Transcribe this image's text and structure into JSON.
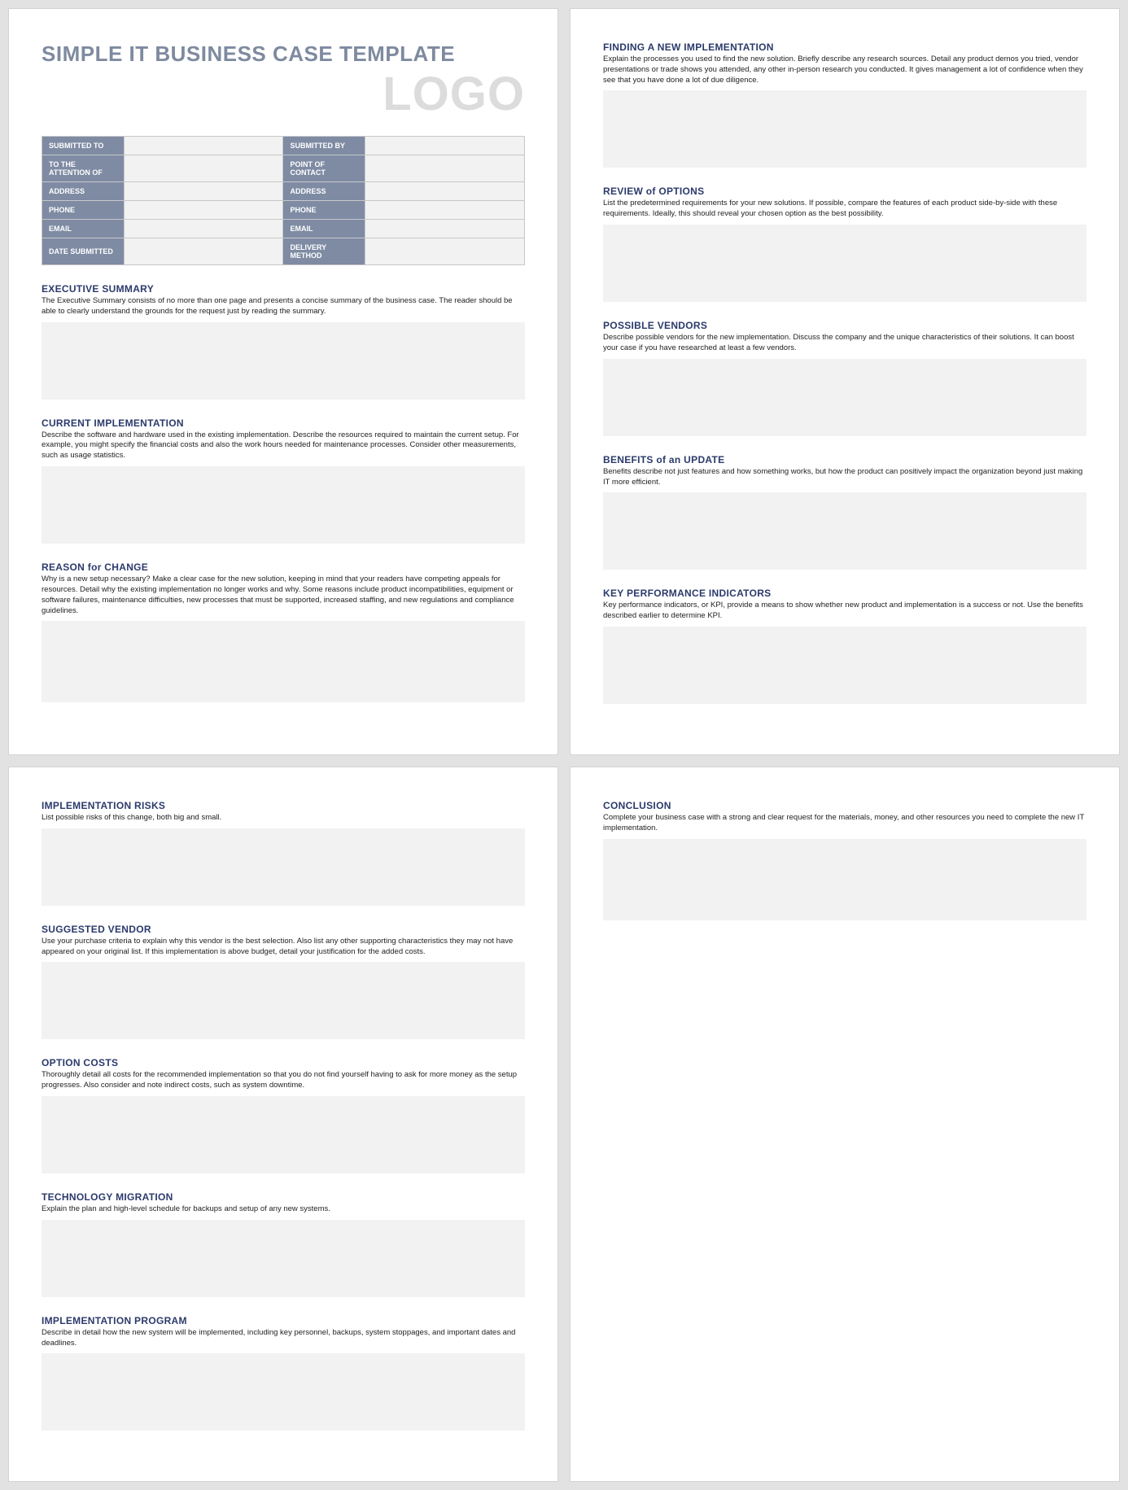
{
  "doc_title": "SIMPLE IT BUSINESS CASE TEMPLATE",
  "logo_text": "LOGO",
  "header_table": {
    "rows": [
      {
        "l1": "SUBMITTED TO",
        "l2": "SUBMITTED BY"
      },
      {
        "l1": "TO THE ATTENTION OF",
        "l2": "POINT OF CONTACT"
      },
      {
        "l1": "ADDRESS",
        "l2": "ADDRESS"
      },
      {
        "l1": "PHONE",
        "l2": "PHONE"
      },
      {
        "l1": "EMAIL",
        "l2": "EMAIL"
      },
      {
        "l1": "DATE SUBMITTED",
        "l2": "DELIVERY METHOD"
      }
    ]
  },
  "sections": {
    "exec_summary": {
      "title": "EXECUTIVE SUMMARY",
      "desc": "The Executive Summary consists of no more than one page and presents a concise summary of the business case. The reader should be able to clearly understand the grounds for the request just by reading the summary."
    },
    "current_impl": {
      "title": "CURRENT IMPLEMENTATION",
      "desc": "Describe the software and hardware used in the existing implementation. Describe the resources required to maintain the current setup. For example, you might specify the financial costs and also the work hours needed for maintenance processes. Consider other measurements, such as usage statistics."
    },
    "reason_change": {
      "title": "REASON for CHANGE",
      "desc": "Why is a new setup necessary? Make a clear case for the new solution, keeping in mind that your readers have competing appeals for resources. Detail why the existing implementation no longer works and why. Some reasons include product incompatibilities, equipment or software failures, maintenance difficulties, new processes that must be supported, increased staffing, and new regulations and compliance guidelines."
    },
    "finding_impl": {
      "title": "FINDING A NEW IMPLEMENTATION",
      "desc": "Explain the processes you used to find the new solution. Briefly describe any research sources. Detail any product demos you tried, vendor presentations or trade shows you attended, any other in-person research you conducted. It gives management a lot of confidence when they see that you have done a lot of due diligence."
    },
    "review_options": {
      "title": "REVIEW of OPTIONS",
      "desc": "List the predetermined requirements for your new solutions. If possible, compare the features of each product side-by-side with these requirements. Ideally, this should reveal your chosen option as the best possibility."
    },
    "possible_vendors": {
      "title": "POSSIBLE VENDORS",
      "desc": "Describe possible vendors for the new implementation. Discuss the company and the unique characteristics of their solutions. It can boost your case if you have researched at least a few vendors."
    },
    "benefits_update": {
      "title": "BENEFITS of an UPDATE",
      "desc": "Benefits describe not just features and how something works, but how the product can positively impact the organization beyond just making IT more efficient."
    },
    "kpi": {
      "title": "KEY PERFORMANCE INDICATORS",
      "desc": "Key performance indicators, or KPI, provide a means to show whether new product and implementation is a success or not. Use the benefits described earlier to determine KPI."
    },
    "impl_risks": {
      "title": "IMPLEMENTATION RISKS",
      "desc": "List possible risks of this change, both big and small."
    },
    "suggested_vendor": {
      "title": "SUGGESTED VENDOR",
      "desc": "Use your purchase criteria to explain why this vendor is the best selection. Also list any other supporting characteristics they may not have appeared on your original list. If this implementation is above budget, detail your justification for the added costs."
    },
    "option_costs": {
      "title": "OPTION COSTS",
      "desc": "Thoroughly detail all costs for the recommended implementation so that you do not find yourself having to ask for more money as the setup progresses. Also consider and note indirect costs, such as system downtime."
    },
    "tech_migration": {
      "title": "TECHNOLOGY MIGRATION",
      "desc": "Explain the plan and high-level schedule for backups and setup of any new systems."
    },
    "impl_program": {
      "title": "IMPLEMENTATION PROGRAM",
      "desc": "Describe in detail how the new system will be implemented, including key personnel, backups, system stoppages, and important dates and deadlines."
    },
    "conclusion": {
      "title": "CONCLUSION",
      "desc": "Complete your business case with a strong and clear request for the materials, money, and other resources you need to complete the new IT implementation."
    }
  }
}
